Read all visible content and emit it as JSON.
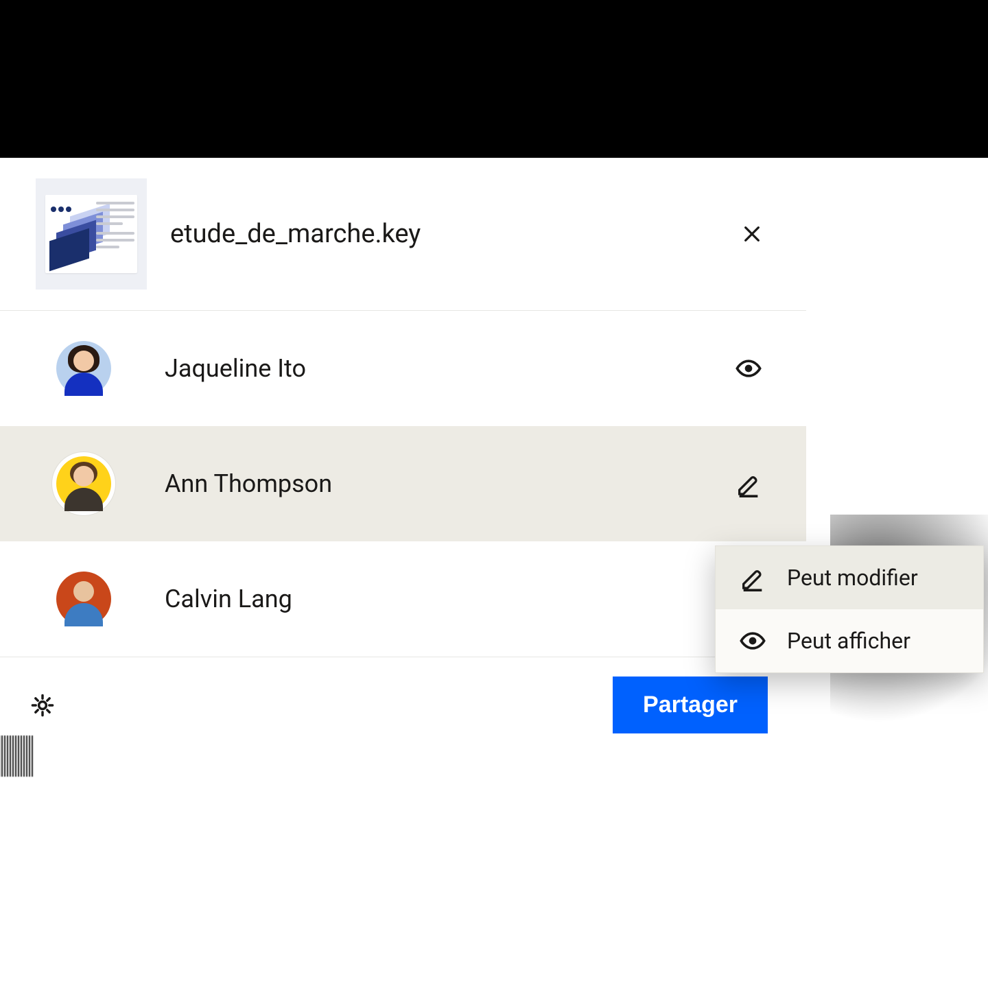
{
  "header": {
    "file_name": "etude_de_marche.key"
  },
  "people": [
    {
      "name": "Jaqueline Ito",
      "permission": "view"
    },
    {
      "name": "Ann Thompson",
      "permission": "edit"
    },
    {
      "name": "Calvin Lang",
      "permission": "none"
    }
  ],
  "menu": {
    "edit_label": "Peut modifier",
    "view_label": "Peut afficher"
  },
  "footer": {
    "share_label": "Partager"
  },
  "colors": {
    "primary": "#0061fe",
    "highlight": "#edebe4"
  }
}
